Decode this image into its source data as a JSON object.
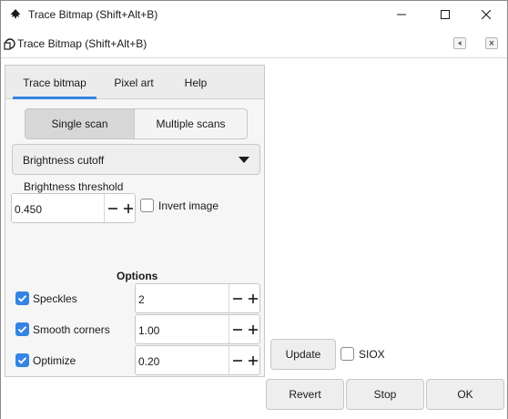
{
  "window": {
    "title": "Trace Bitmap (Shift+Alt+B)",
    "controls": {
      "minimize_icon": "minimize-icon",
      "maximize_icon": "maximize-icon",
      "close_icon": "close-icon"
    }
  },
  "dock": {
    "title": "Trace Bitmap (Shift+Alt+B)"
  },
  "tabs": [
    {
      "label": "Trace bitmap",
      "active": true
    },
    {
      "label": "Pixel art",
      "active": false
    },
    {
      "label": "Help",
      "active": false
    }
  ],
  "scan_mode": {
    "single_label": "Single scan",
    "multiple_label": "Multiple scans",
    "selected": "Single scan"
  },
  "detection": {
    "mode": "Brightness cutoff",
    "threshold_label": "Brightness threshold",
    "threshold_value": "0.450",
    "invert_label": "Invert image",
    "invert_checked": false
  },
  "options": {
    "heading": "Options",
    "speckles": {
      "label": "Speckles",
      "checked": true,
      "value": "2"
    },
    "smooth_corners": {
      "label": "Smooth corners",
      "checked": true,
      "value": "1.00"
    },
    "optimize": {
      "label": "Optimize",
      "checked": true,
      "value": "0.20"
    }
  },
  "preview": {
    "update_label": "Update",
    "siox_label": "SIOX",
    "siox_checked": false
  },
  "footer": {
    "revert_label": "Revert",
    "stop_label": "Stop",
    "ok_label": "OK"
  },
  "colors": {
    "accent": "#3584e4",
    "panel_bg": "#f6f6f6",
    "button_bg": "#eeeeee",
    "border": "#c7c7c7"
  }
}
